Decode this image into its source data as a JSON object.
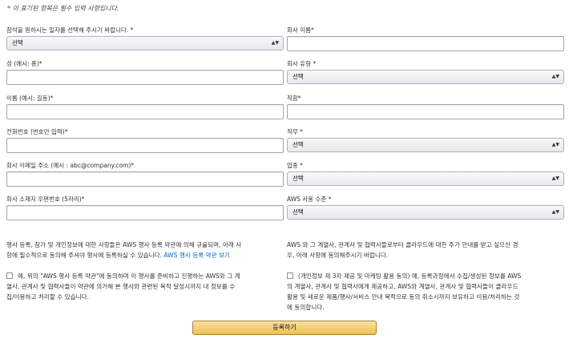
{
  "form": {
    "required_note": "* 이 표기된 항목은 필수 입력 사항입니다.",
    "fields_left": [
      {
        "label": "참석을 원하시는 일자를 선택해 주시기 바랍니다. *",
        "type": "select",
        "value": "선택"
      },
      {
        "label": "성 (예시: 홍)*",
        "type": "input",
        "value": ""
      },
      {
        "label": "이름 (예시: 길동)*",
        "type": "input",
        "value": ""
      },
      {
        "label": "전화번호 (번호만 입력)*",
        "type": "input",
        "value": ""
      },
      {
        "label": "회사 이메일 주소 (예시 : abc@company.com)*",
        "type": "input",
        "value": ""
      },
      {
        "label": "회사 소재지 우편번호 (5자리)*",
        "type": "input",
        "value": ""
      }
    ],
    "fields_right": [
      {
        "label": "회사 이름*",
        "type": "input",
        "value": ""
      },
      {
        "label": "회사 유형 *",
        "type": "select",
        "value": "선택"
      },
      {
        "label": "직함*",
        "type": "input",
        "value": ""
      },
      {
        "label": "직무 *",
        "type": "select",
        "value": "선택"
      },
      {
        "label": "업종 *",
        "type": "select",
        "value": "선택"
      },
      {
        "label": "AWS 사용 수준 *",
        "type": "select",
        "value": "선택"
      }
    ]
  },
  "consent": {
    "terms_text_1": "행사 등록, 참가 및 개인정보에 대한 사항들은 AWS 행사 등록 약관에 의해 규율되며, 아래 사",
    "terms_text_2": "항에 필수적으로 동의해 주셔야 행사에 등록하실 수 있습니다.",
    "terms_link": "AWS 행사 등록 약관 보기",
    "marketing_text_1": "AWS 와 그 계열사, 관계사 및 협력사들로부터 클라우드에 대한 주가 안내를 받고 싶으신 경",
    "marketing_text_2": "우, 아래 사항에 동의해주시기 바랍니다.",
    "checkbox_left_lines": [
      "예, 위의 \"AWS 행사 등록 약관\"에 동의하며 이 행사를 준비하고 진행하는 AWS와 그 계",
      "열사, 관계사 및 협력사들이 약관에 의거해 본 행사와 관련된 목적 달성시까지 내 정보를 수",
      "집/이용하고 처리할 수 있습니다."
    ],
    "checkbox_right_lines": [
      "(개인정보 제 3자 제공 및 마케팅 활용 동의) 예, 등록과정에서 수집/생성된 정보를 AWS",
      "의 계열사, 관계사 및 협력사에게 제공하고, AWS와 계열사, 관계사 및 협력사들이 클라우드",
      "활용 및 새로운 제품/행사/서비스 안내 목적으로 동의 취소시까지 보유하고 이용/처리하는 것",
      "에 동의합니다."
    ]
  },
  "submit_label": "등록하기"
}
